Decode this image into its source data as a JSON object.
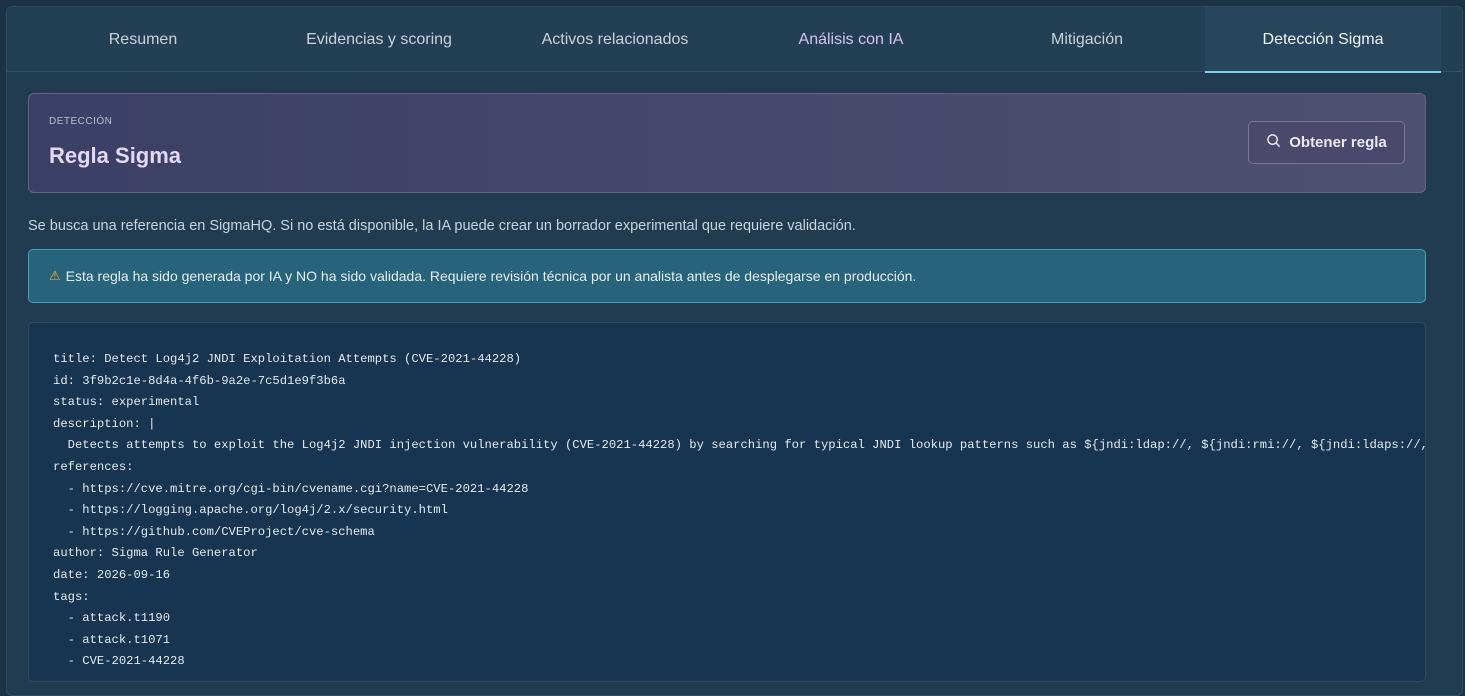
{
  "tabs": [
    {
      "label": "Resumen"
    },
    {
      "label": "Evidencias y scoring"
    },
    {
      "label": "Activos relacionados"
    },
    {
      "label": "Análisis con IA"
    },
    {
      "label": "Mitigación"
    },
    {
      "label": "Detección Sigma"
    }
  ],
  "active_tab": "Detección Sigma",
  "header": {
    "eyebrow": "DETECCIÓN",
    "title": "Regla Sigma",
    "button_label": "Obtener regla",
    "button_icon": "search-icon"
  },
  "description": "Se busca una referencia en SigmaHQ. Si no está disponible, la IA puede crear un borrador experimental que requiere validación.",
  "warning": {
    "icon": "warning-icon",
    "text": "Esta regla ha sido generada por IA y NO ha sido validada. Requiere revisión técnica por un analista antes de desplegarse en producción."
  },
  "code_lines": [
    "title: Detect Log4j2 JNDI Exploitation Attempts (CVE-2021-44228)",
    "id: 3f9b2c1e-8d4a-4f6b-9a2e-7c5d1e9f3b6a",
    "status: experimental",
    "description: |",
    "  Detects attempts to exploit the Log4j2 JNDI injection vulnerability (CVE-2021-44228) by searching for typical JNDI lookup patterns such as ${jndi:ldap://, ${jndi:rmi://, ${jndi:ldaps://, ${",
    "references:",
    "  - https://cve.mitre.org/cgi-bin/cvename.cgi?name=CVE-2021-44228",
    "  - https://logging.apache.org/log4j/2.x/security.html",
    "  - https://github.com/CVEProject/cve-schema",
    "author: Sigma Rule Generator",
    "date: 2026-09-16",
    "tags:",
    "  - attack.t1190",
    "  - attack.t1071",
    "  - CVE-2021-44228"
  ]
}
